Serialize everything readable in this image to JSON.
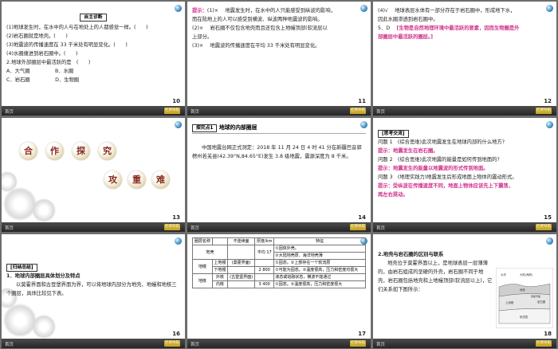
{
  "footer": {
    "text": "首页",
    "back_button": "栏目导航"
  },
  "slides": [
    {
      "page": "10",
      "tag": "自主诊断",
      "lines": [
        "(1)地球发生时，在水中的人与在地处上的人都感觉一样。(　　)",
        "(2)岩石圈就是地壳。(　　)",
        "(3)地震波的传播速度在 33 千米处有明显变化。(　　)",
        "(4)水圈缠进到岩石圈中。(　　)",
        "2.地球外部圈层中最活跃的是　(　　)",
        "A．大气圈　　　　　B．水圈",
        "C．岩石圈　　　　　D．生物圈"
      ]
    },
    {
      "page": "11",
      "lines": [
        [
          {
            "t": "提示：",
            "h": true
          },
          {
            "t": "(1)× 　地震发生时，在水中的人只能感受到纵波的影响，"
          }
        ],
        [
          {
            "t": "而在陆地上的人可以感受到横波、纵波两种地震波的影响。"
          }
        ],
        [
          {
            "t": "(2)× 　岩石圈不仅包含地壳而且还包含上地幔顶部(软流层以"
          }
        ],
        [
          {
            "t": "上部分。"
          }
        ],
        [
          {
            "t": "(3)× 　地震波的传播速度在平均 33 千米处有明显变化。"
          }
        ]
      ]
    },
    {
      "page": "12",
      "lines": [
        [
          {
            "t": "(4)√ 　地球表层水体有一部分存在于岩石圈中，形成地下水，"
          }
        ],
        [
          {
            "t": "因此水圈渗透到岩石圈中。"
          }
        ],
        [
          {
            "t": "5．D 　"
          },
          {
            "t": "[生物是自然地理环境中最活跃的要素，因而生物圈是外",
            "h": true
          }
        ],
        [
          {
            "t": "部圈层中最活跃的圈层。]",
            "h": true
          }
        ]
      ]
    },
    {
      "page": "13",
      "chars1": [
        "合",
        "作",
        "探",
        "究"
      ],
      "chars2": [
        "攻",
        "重",
        "难"
      ]
    },
    {
      "page": "14",
      "tag": "探究点1",
      "heading": "地球的内部圈层",
      "body": "中国地震台网正式测定：2018 年 11 月 24 日 4 时 41 分在新疆巴音郭楞州若羌县(42.39°N,84.65°E)发生 3.8 级地震，震源深度为 8 千米。"
    },
    {
      "page": "15",
      "tag": "[思考交流]",
      "lines": [
        [
          {
            "t": "问题 1　(综合思维)此次地震发生在地球内部的什么地方?"
          }
        ],
        [
          {
            "t": "提示：",
            "h": true
          },
          {
            "t": "地震发生在岩石圈。",
            "h": true
          }
        ],
        [
          {
            "t": "问题 2　(综合思维)此次地震的能量是如何传到地面的?"
          }
        ],
        [
          {
            "t": "提示：",
            "h": true
          },
          {
            "t": "地震发生的能量以地震波的形式传到地面。",
            "h": true
          }
        ],
        [
          {
            "t": "问题 3　(地理实践力)地震发生后形成地面上物体的震动形式。"
          }
        ],
        [
          {
            "t": "提示：",
            "h": true
          },
          {
            "t": "受纵波在传播速度不同，地面上物体应该先上下震荡，",
            "h": true
          }
        ],
        [
          {
            "t": "再左右晃动。",
            "h": true
          }
        ]
      ]
    },
    {
      "page": "16",
      "tag": "[归纳总结]",
      "title": "1．地球内部圈层具体划分及特点",
      "body": "以莫霍界面和古登堡界面为界，可以将地球内部分为地壳、地幔和地核三个圈层，具体比较见下表。"
    },
    {
      "page": "17",
      "headers": [
        "圈层名称",
        "不连续面",
        "厚度/km",
        "特征"
      ],
      "rows": [
        [
          "地壳",
          "",
          "平均 17",
          "①固体外壳。"
        ],
        [
          "",
          "",
          "",
          "②大陆地壳厚、海洋地壳薄"
        ],
        [
          "地幔",
          "上地幔",
          "(莫霍界面)",
          "①固态。②上部存在一个软流层"
        ],
        [
          "",
          "下地幔",
          "2 800",
          "①可能为固态。②温度很高，压力和密度均很大"
        ],
        [
          "地核",
          "外核",
          "(古登堡界面)",
          "液态或熔融状态，横波不能通过"
        ],
        [
          "",
          "内核",
          "3 400",
          "①固态。②温度很高，压力和密度很大"
        ]
      ]
    },
    {
      "page": "18",
      "title": "2.地壳与岩石圈的区别与联系",
      "body": "地壳位于莫霍界面以上，是地球表层一层薄薄的，由岩石组成的坚硬的外壳，岩石圈不同于地壳，岩石圈包括地壳和上地幔顶部(软流层以上)，它们关系如下图所示：",
      "diagram_labels": [
        "大洋",
        "大陆(海底)",
        "地壳",
        "岩石圈",
        "上地幔",
        "软流层",
        "莫霍界面"
      ]
    }
  ]
}
